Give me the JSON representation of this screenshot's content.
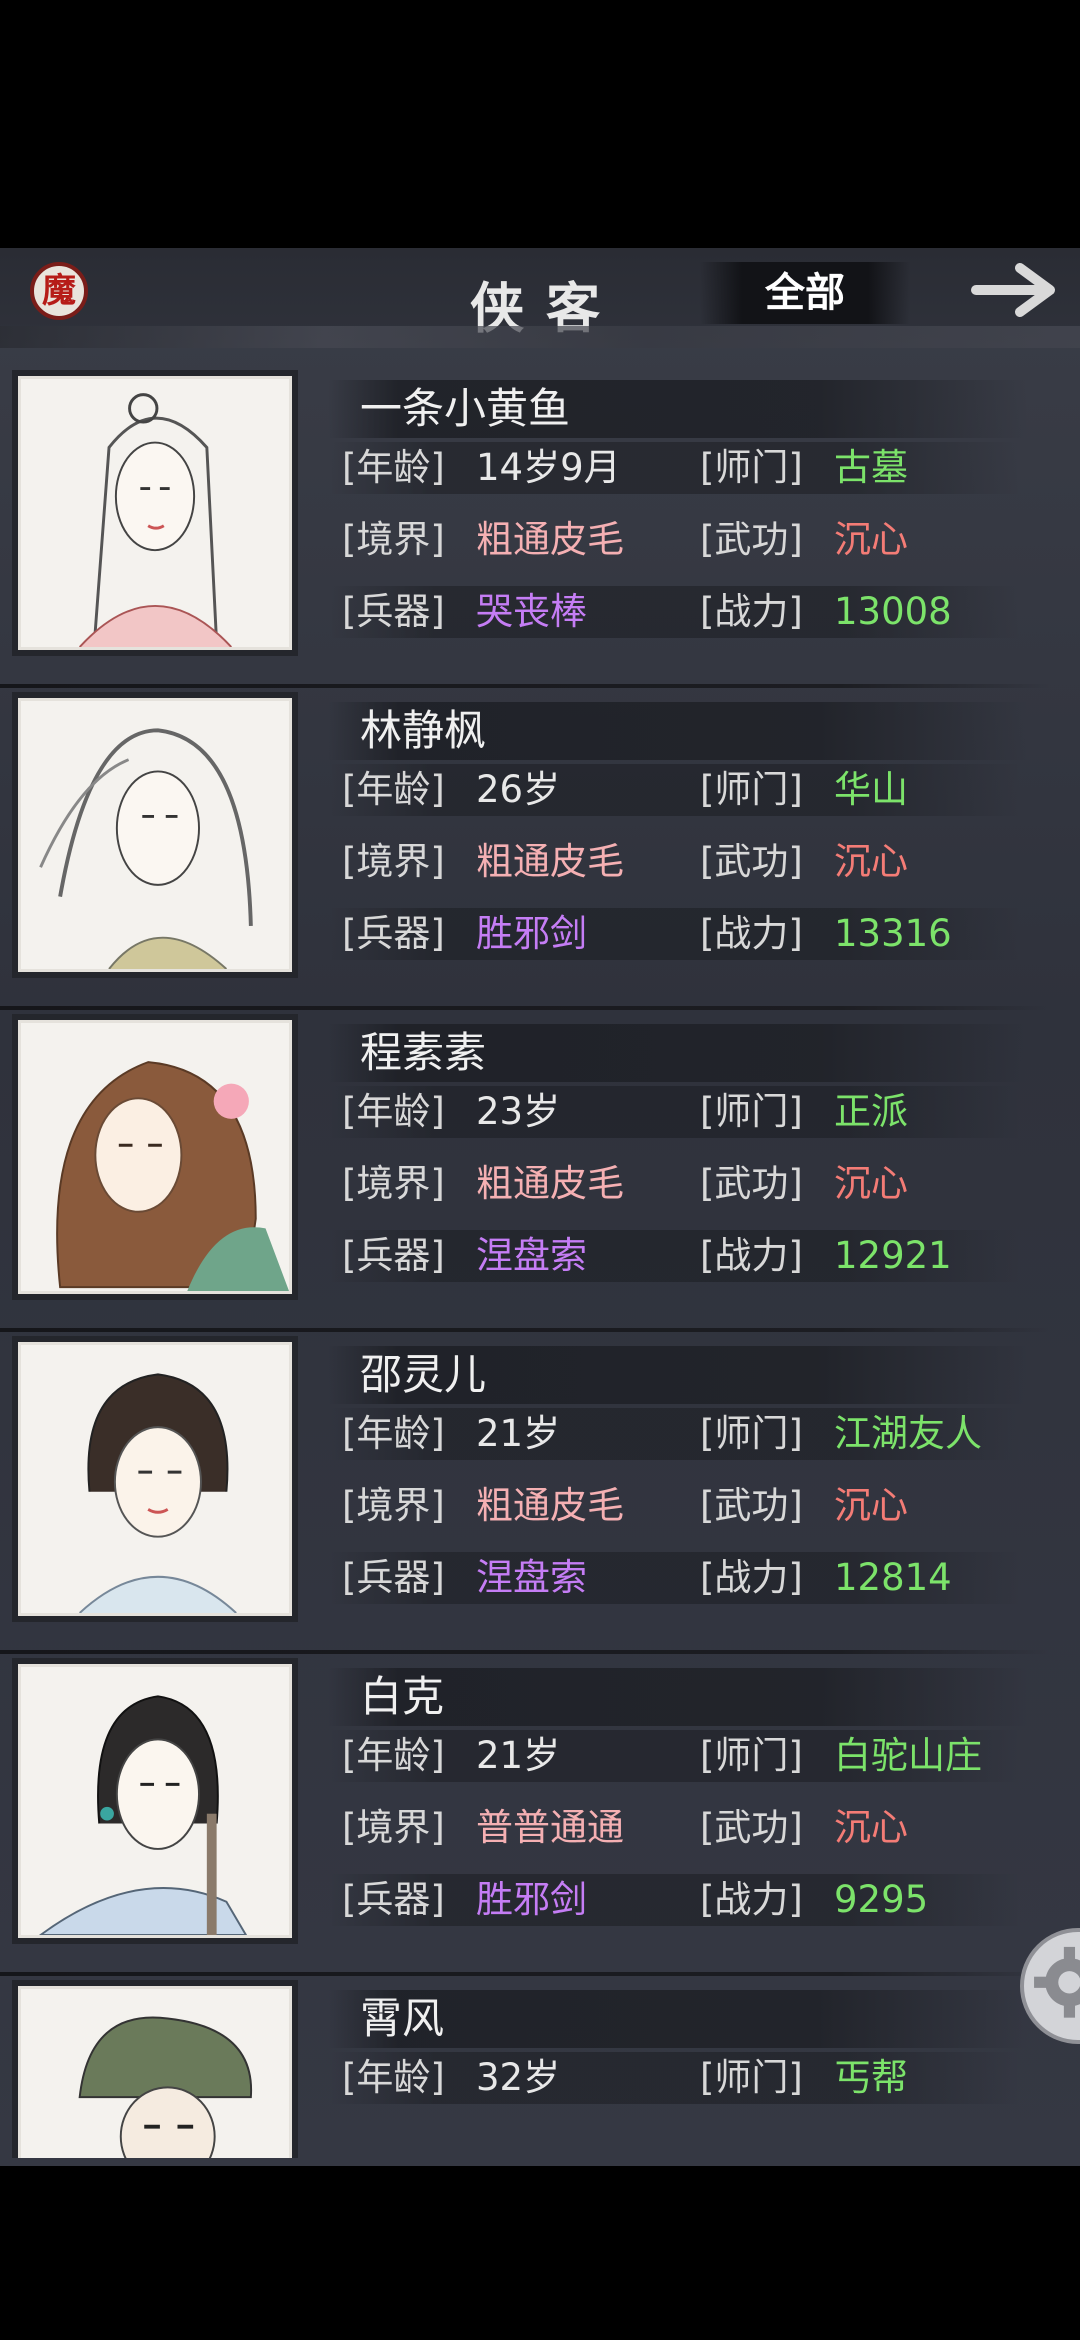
{
  "header": {
    "demon_label": "魔",
    "title": "侠客",
    "filter": "全部"
  },
  "labels": {
    "age": "[年龄]",
    "realm": "[境界]",
    "weapon": "[兵器]",
    "sect": "[师门]",
    "skill": "[武功]",
    "power": "[战力]"
  },
  "characters": [
    {
      "name": "一条小黄鱼",
      "age": "14岁9月",
      "realm": "粗通皮毛",
      "weapon": "哭丧棒",
      "sect": "古墓",
      "skill": "沉心",
      "power": "13008"
    },
    {
      "name": "林静枫",
      "age": "26岁",
      "realm": "粗通皮毛",
      "weapon": "胜邪剑",
      "sect": "华山",
      "skill": "沉心",
      "power": "13316"
    },
    {
      "name": "程素素",
      "age": "23岁",
      "realm": "粗通皮毛",
      "weapon": "涅盘索",
      "sect": "正派",
      "skill": "沉心",
      "power": "12921"
    },
    {
      "name": "邵灵儿",
      "age": "21岁",
      "realm": "粗通皮毛",
      "weapon": "涅盘索",
      "sect": "江湖友人",
      "skill": "沉心",
      "power": "12814"
    },
    {
      "name": "白克",
      "age": "21岁",
      "realm": "普普通通",
      "weapon": "胜邪剑",
      "sect": "白驼山庄",
      "skill": "沉心",
      "power": "9295"
    },
    {
      "name": "霄风",
      "age": "32岁",
      "realm": "",
      "weapon": "",
      "sect": "丐帮",
      "skill": "",
      "power": ""
    }
  ],
  "colors": {
    "realm_rookie": "#f5b0b3",
    "weapon": "#c57df5",
    "sect": "#7ce36a",
    "skill": "#f47c76",
    "power": "#7ce36a"
  },
  "icons": [
    "demon-badge-icon",
    "arrow-right-icon",
    "gear-icon"
  ]
}
